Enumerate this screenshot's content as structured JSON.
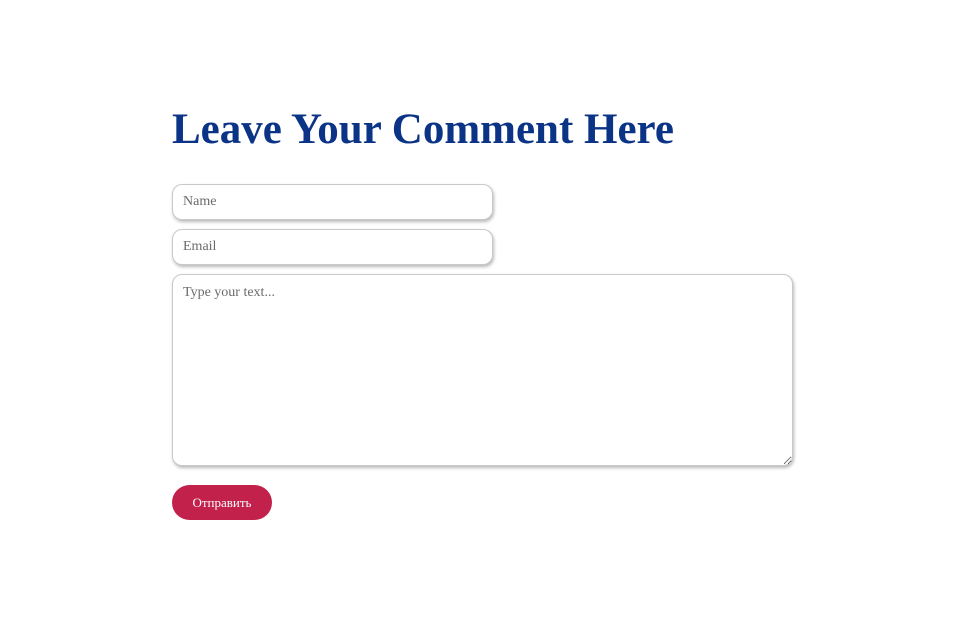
{
  "page": {
    "title": "Leave Your Comment Here"
  },
  "form": {
    "name_placeholder": "Name",
    "email_placeholder": "Email",
    "message_placeholder": "Type your text...",
    "submit_label": "Отправить"
  },
  "colors": {
    "title": "#0b3386",
    "submit_button": "#c1214b",
    "submit_text": "#ffffff",
    "background": "#ffffff"
  }
}
